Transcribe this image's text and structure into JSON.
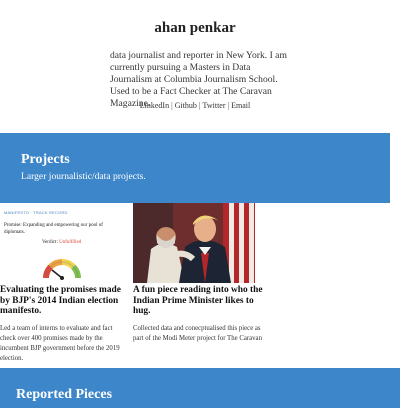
{
  "header": {
    "title": "ahan penkar",
    "bio": "data journalist and reporter in New York. I am currently pursuing a Masters in Data Journalism at Columbia Journalism School. Used to be a Fact Checker at The Caravan Magazine.",
    "links": [
      {
        "label": "LinkedIn"
      },
      {
        "label": "Github"
      },
      {
        "label": "Twitter"
      },
      {
        "label": "Email"
      }
    ],
    "separator": "|"
  },
  "projects": {
    "title": "Projects",
    "subtitle": "Larger journalistic/data projects.",
    "cards": [
      {
        "title": "Evaluating the promises made by BJP's 2014 Indian election manifesto.",
        "description": "Led a team of interns to evaluate and fact check over 400 promises made by the incumbent BJP government before the 2019 election.",
        "thumbnail": {
          "brand": "MANIFESTO · TRACK RECORD",
          "promise": "Promise: Expanding and empowering our pool of diplomats.",
          "verdict_label": "Verdict:",
          "verdict_value": "Unfulfilled"
        }
      },
      {
        "title": "A fun piece reading into who the Indian Prime Minister likes to hug.",
        "description": "Collected data and conecptualised this piece as part of the Modi Meter project for The Caravan"
      }
    ]
  },
  "reported": {
    "title": "Reported Pieces"
  },
  "colors": {
    "band": "#3d86c9",
    "verdict": "#d94a38"
  }
}
